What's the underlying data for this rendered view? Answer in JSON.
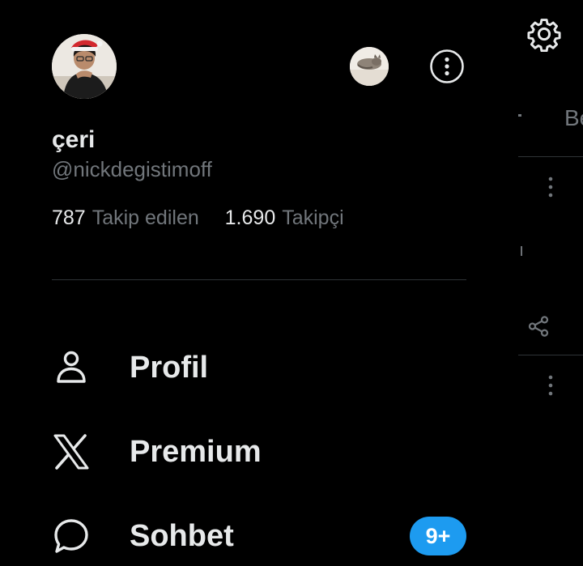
{
  "profile": {
    "display_name": "çeri",
    "handle": "@nickdegistimoff",
    "following_count": "787",
    "following_label": "Takip edilen",
    "followers_count": "1.690",
    "followers_label": "Takipçi"
  },
  "menu": {
    "items": [
      {
        "label": "Profil",
        "icon": "person-icon"
      },
      {
        "label": "Premium",
        "icon": "x-logo-icon"
      },
      {
        "label": "Sohbet",
        "icon": "chat-bubble-icon",
        "badge": "9+"
      }
    ]
  },
  "background": {
    "tab_fragment": "Be",
    "text_fragment": "ı"
  },
  "colors": {
    "background": "#000000",
    "primary_text": "#e7e9ea",
    "secondary_text": "#71767b",
    "divider": "#2f3336",
    "accent": "#1d9bf0"
  }
}
